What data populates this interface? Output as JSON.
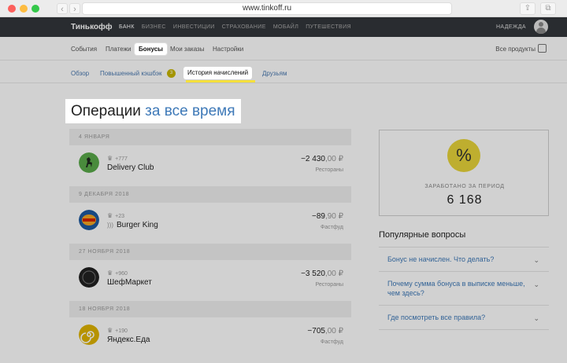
{
  "browser": {
    "url": "www.tinkoff.ru"
  },
  "header": {
    "brand": "Тинькофф",
    "nav": [
      "БАНК",
      "БИЗНЕС",
      "ИНВЕСТИЦИИ",
      "СТРАХОВАНИЕ",
      "МОБАЙЛ",
      "ПУТЕШЕСТВИЯ"
    ],
    "user": "НАДЕЖДА"
  },
  "subnav": {
    "items": [
      "События",
      "Платежи",
      "Бонусы",
      "Мои заказы",
      "Настройки"
    ],
    "active": "Бонусы",
    "all_products": "Все продукты"
  },
  "tabs": {
    "items": [
      "Обзор",
      "Повышенный кэшбэк",
      "История начислений",
      "Друзьям"
    ],
    "badge": "3",
    "active": "История начислений"
  },
  "heading": {
    "part1": "Операции",
    "part2": "за все время"
  },
  "operations": [
    {
      "date": "4 ЯНВАРЯ",
      "points": "+777",
      "name": "Delivery Club",
      "amount_int": "−2 430",
      "amount_dec": ",00 ₽",
      "category": "Рестораны",
      "color": "#5aaa4a"
    },
    {
      "date": "9 ДЕКАБРЯ 2018",
      "points": "+23",
      "name": "Burger King",
      "amount_int": "−89",
      "amount_dec": ",90 ₽",
      "category": "Фастфуд",
      "color": "#1e5aa0"
    },
    {
      "date": "27 НОЯБРЯ 2018",
      "points": "+960",
      "name": "ШефМаркет",
      "amount_int": "−3 520",
      "amount_dec": ",00 ₽",
      "category": "Рестораны",
      "color": "#222222"
    },
    {
      "date": "18 НОЯБРЯ 2018",
      "points": "+190",
      "name": "Яндекс.Еда",
      "amount_int": "−705",
      "amount_dec": ",00 ₽",
      "category": "Фастфуд",
      "color": "#e0b400"
    }
  ],
  "summary": {
    "symbol": "%",
    "label": "ЗАРАБОТАНО ЗА ПЕРИОД",
    "value": "6 168"
  },
  "faq": {
    "title": "Популярные вопросы",
    "items": [
      "Бонус не начислен. Что делать?",
      "Почему сумма бонуса в выписке меньше, чем здесь?",
      "Где посмотреть все правила?"
    ]
  }
}
